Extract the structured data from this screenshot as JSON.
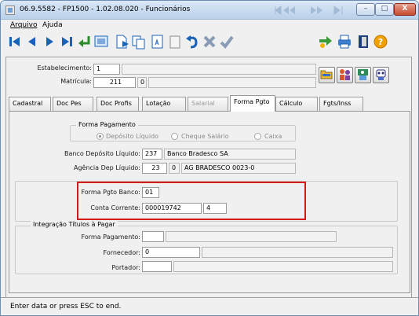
{
  "window": {
    "title": "06.9.5582 - FP1500 - 1.02.08.020 - Funcionários",
    "minimize_glyph": "–",
    "maximize_glyph": "□",
    "close_glyph": "X"
  },
  "menu": {
    "items": [
      "Arquivo",
      "Ajuda"
    ]
  },
  "toolbar": {
    "icons": [
      "first-record-icon",
      "previous-record-icon",
      "next-record-icon",
      "last-record-icon",
      "enter-icon",
      "zoom-icon",
      "new-document-icon",
      "copy-icon",
      "edit-icon",
      "delete-icon",
      "undo-icon",
      "cancel-icon",
      "confirm-icon",
      "navigate-icon",
      "print-icon",
      "exit-icon",
      "help-icon"
    ]
  },
  "header": {
    "estabelecimento_label": "Estabelecimento:",
    "estabelecimento_value": "1",
    "matricula_label": "Matrícula:",
    "matricula_value": "211",
    "matricula_digit": "0"
  },
  "side_buttons": [
    "open-folder-icon",
    "people-icon",
    "search-person-icon",
    "robot-icon"
  ],
  "tabs": [
    {
      "label": "Cadastral",
      "state": "normal"
    },
    {
      "label": "Doc Pes",
      "state": "normal"
    },
    {
      "label": "Doc Profis",
      "state": "normal"
    },
    {
      "label": "Lotação",
      "state": "normal"
    },
    {
      "label": "Salarial",
      "state": "disabled"
    },
    {
      "label": "Forma Pgto",
      "state": "active"
    },
    {
      "label": "Cálculo",
      "state": "normal"
    },
    {
      "label": "Fgts/Inss",
      "state": "normal"
    }
  ],
  "forma_pagamento": {
    "group_title": "Forma Pagamento",
    "options": [
      "Depósito Líquido",
      "Cheque Salário",
      "Caixa"
    ],
    "selected": "Depósito Líquido",
    "banco_label": "Banco Depósito Líquido:",
    "banco_code": "237",
    "banco_name": "Banco Bradesco SA",
    "agencia_label": "Agência Dep Líquido:",
    "agencia_code": "23",
    "agencia_digit": "0",
    "agencia_name": "AG BRADESCO 0023-0"
  },
  "pgto_banco": {
    "forma_label": "Forma Pgto Banco:",
    "forma_value": "01",
    "conta_label": "Conta Corrente:",
    "conta_value": "000019742",
    "conta_digit": "4"
  },
  "integracao": {
    "group_title": "Integração Títulos à Pagar",
    "forma_label": "Forma Pagamento:",
    "fornecedor_label": "Fornecedor:",
    "fornecedor_value": "0",
    "portador_label": "Portador:"
  },
  "status": {
    "text": "Enter data or press ESC to end."
  },
  "colors": {
    "highlight": "#d31b1b",
    "toolbar_blue": "#1a62b5"
  }
}
